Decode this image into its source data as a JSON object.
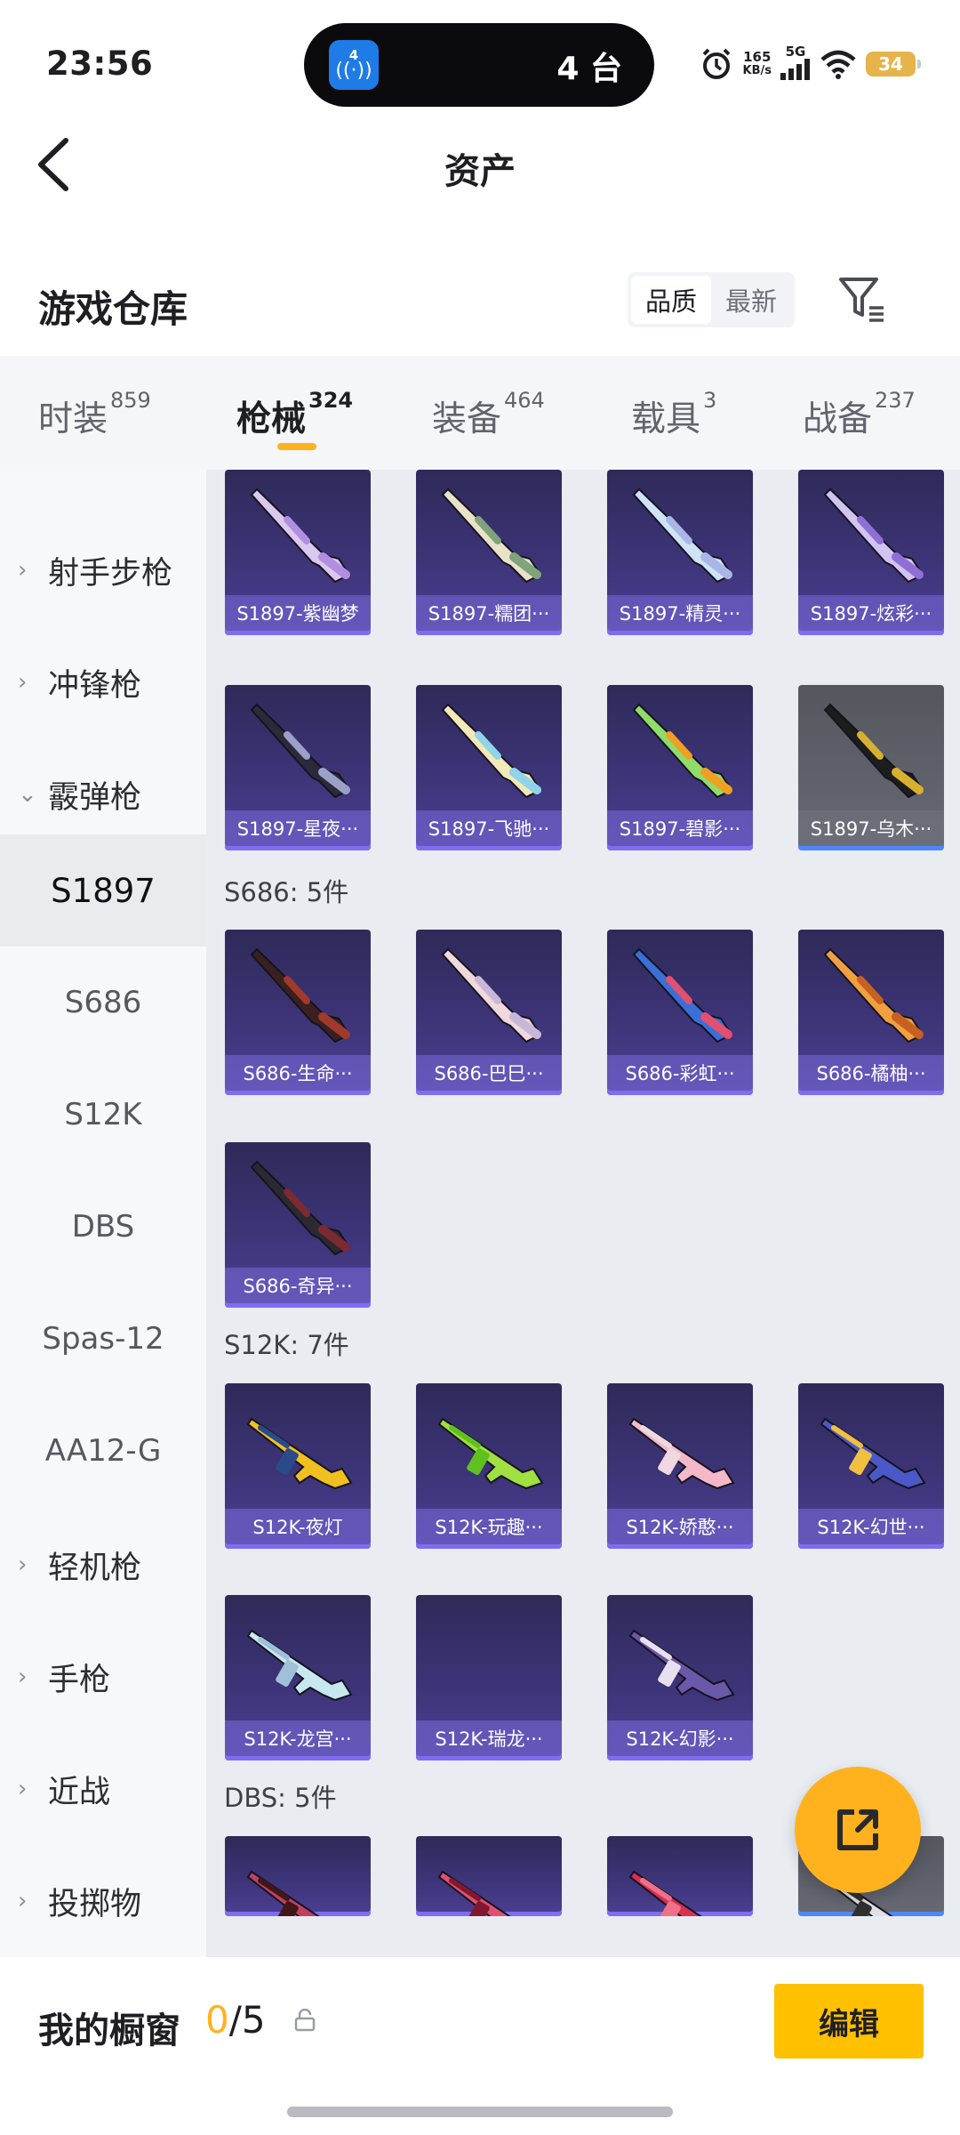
{
  "status": {
    "time": "23:56",
    "island_app_badge": "4",
    "island_text": "4 台",
    "net_speed_value": "165",
    "net_speed_unit": "KB/s",
    "network": "5G",
    "battery": "34"
  },
  "header": {
    "title": "资产",
    "back_icon": "chevron-left-icon"
  },
  "store": {
    "title": "游戏仓库",
    "sort_options": [
      "品质",
      "最新"
    ],
    "sort_selected": "品质",
    "filter_icon": "filter-icon"
  },
  "tabs": [
    {
      "label": "时装",
      "count": "859"
    },
    {
      "label": "枪械",
      "count": "324",
      "active": true
    },
    {
      "label": "装备",
      "count": "464"
    },
    {
      "label": "载具",
      "count": "3"
    },
    {
      "label": "战备",
      "count": "237"
    }
  ],
  "sidebar": {
    "groups_top": [
      "射手步枪",
      "冲锋枪",
      "霰弹枪"
    ],
    "subs": [
      "S1897",
      "S686",
      "S12K",
      "DBS",
      "Spas-12",
      "AA12-G"
    ],
    "selected_sub": "S1897",
    "groups_bottom": [
      "轻机枪",
      "手枪",
      "近战",
      "投掷物"
    ]
  },
  "sections": [
    {
      "label": "",
      "items": [
        "S1897-紫幽梦",
        "S1897-糯团···",
        "S1897-精灵···",
        "S1897-炫彩···",
        "S1897-星夜···",
        "S1897-飞驰···",
        "S1897-碧影···",
        "S1897-乌木···"
      ]
    },
    {
      "label": "S686: 5件",
      "items": [
        "S686-生命···",
        "S686-巴巳···",
        "S686-彩虹···",
        "S686-橘柚···",
        "S686-奇异···"
      ]
    },
    {
      "label": "S12K: 7件",
      "items": [
        "S12K-夜灯",
        "S12K-玩趣···",
        "S12K-娇憨···",
        "S12K-幻世···",
        "S12K-龙宫···",
        "S12K-瑞龙···",
        "S12K-幻影···"
      ]
    },
    {
      "label": "DBS: 5件",
      "items": [
        "",
        "",
        "",
        ""
      ]
    }
  ],
  "fab_icon": "share-external-icon",
  "bottom": {
    "window_label": "我的橱窗",
    "count_current": "0",
    "count_separator": "/",
    "count_total": "5",
    "lock_icon": "lock-icon",
    "edit_label": "编辑"
  },
  "colors": {
    "accent": "#ffb21e",
    "card_purple": "#3d3478",
    "card_gray": "#5a5c65"
  }
}
